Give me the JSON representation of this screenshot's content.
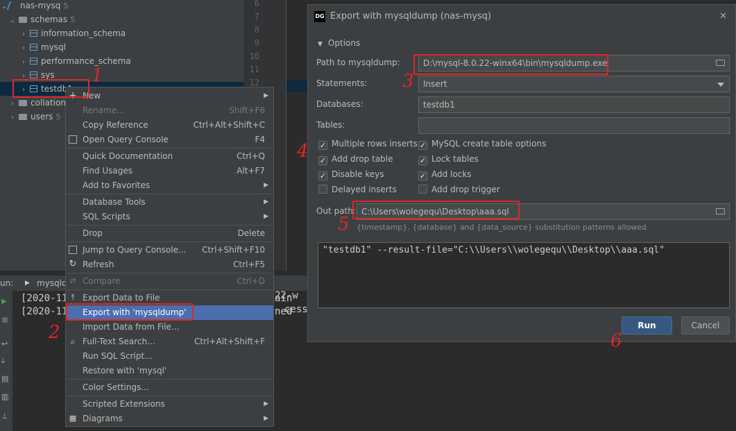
{
  "tree": {
    "root": {
      "label": "nas-mysq",
      "count": "5"
    },
    "schemas": {
      "label": "schemas",
      "count": "5"
    },
    "items": [
      {
        "label": "information_schema"
      },
      {
        "label": "mysql"
      },
      {
        "label": "performance_schema"
      },
      {
        "label": "sys"
      },
      {
        "label": "testdb1"
      }
    ],
    "collations": {
      "label": "collation"
    },
    "users": {
      "label": "users",
      "count": "5"
    }
  },
  "gutter": {
    "lines": [
      "6",
      "7",
      "8",
      "9",
      "10",
      "11",
      "12"
    ]
  },
  "run": {
    "header_label": "un:",
    "tab_label": "mysqld",
    "lines": [
      "[2020-11",
      "[2020-11"
    ],
    "right_fragments": [
      "ain",
      "cess"
    ],
    "right_fragments2": [
      "22-w",
      "ned"
    ]
  },
  "menu": {
    "items": [
      {
        "label": "New",
        "shortcut": "",
        "submenu": true,
        "icon": "plus-icon"
      },
      {
        "label": "Rename...",
        "shortcut": "Shift+F6",
        "disabled": true
      },
      {
        "label": "Copy Reference",
        "shortcut": "Ctrl+Alt+Shift+C"
      },
      {
        "label": "Open Query Console",
        "shortcut": "F4",
        "icon": "console-icon"
      },
      {
        "label": "Quick Documentation",
        "shortcut": "Ctrl+Q"
      },
      {
        "label": "Find Usages",
        "shortcut": "Alt+F7"
      },
      {
        "label": "Add to Favorites",
        "shortcut": "",
        "submenu": true
      },
      {
        "label": "Database Tools",
        "shortcut": "",
        "submenu": true
      },
      {
        "label": "SQL Scripts",
        "shortcut": "",
        "submenu": true
      },
      {
        "label": "Drop",
        "shortcut": "Delete"
      },
      {
        "label": "Jump to Query Console...",
        "shortcut": "Ctrl+Shift+F10",
        "icon": "console-icon"
      },
      {
        "label": "Refresh",
        "shortcut": "Ctrl+F5",
        "icon": "refresh-icon"
      },
      {
        "label": "Compare",
        "shortcut": "Ctrl+D",
        "disabled": true,
        "icon": "compare-icon"
      },
      {
        "label": "Export Data to File",
        "shortcut": "",
        "icon": "export-icon"
      },
      {
        "label": "Export with 'mysqldump'",
        "shortcut": "",
        "active": true
      },
      {
        "label": "Import Data from File...",
        "shortcut": ""
      },
      {
        "label": "Full-Text Search...",
        "shortcut": "Ctrl+Alt+Shift+F",
        "icon": "search-icon"
      },
      {
        "label": "Run SQL Script...",
        "shortcut": ""
      },
      {
        "label": "Restore with 'mysql'",
        "shortcut": ""
      },
      {
        "label": "Color Settings...",
        "shortcut": ""
      },
      {
        "label": "Scripted Extensions",
        "shortcut": "",
        "submenu": true
      },
      {
        "label": "Diagrams",
        "shortcut": "",
        "submenu": true,
        "icon": "diagram-icon"
      }
    ]
  },
  "dialog": {
    "logo": "DG",
    "title": "Export with mysqldump (nas-mysq)",
    "close_glyph": "✕",
    "options_label": "Options",
    "path_label": "Path to mysqldump:",
    "path_value": "D:\\mysql-8.0.22-winx64\\bin\\mysqldump.exe",
    "statements_label": "Statements:",
    "statements_value": "Insert",
    "databases_label": "Databases:",
    "databases_value": "testdb1",
    "tables_label": "Tables:",
    "tables_value": "",
    "checkboxes": [
      {
        "label": "Multiple rows inserts",
        "checked": true
      },
      {
        "label": "MySQL create table options",
        "checked": true
      },
      {
        "label": "Add drop table",
        "checked": true
      },
      {
        "label": "Lock tables",
        "checked": true
      },
      {
        "label": "Disable keys",
        "checked": true
      },
      {
        "label": "Add locks",
        "checked": true
      },
      {
        "label": "Delayed inserts",
        "checked": false
      },
      {
        "label": "Add drop trigger",
        "checked": false
      }
    ],
    "out_path_label": "Out path:",
    "out_path_value": "C:\\Users\\wolegequ\\Desktop\\aaa.sql",
    "hint": "{timestamp}, {database} and {data_source} substitution patterns allowed",
    "command": "\"testdb1\" --result-file=\"C:\\\\Users\\\\wolegequ\\\\Desktop\\\\aaa.sql\"",
    "run_label": "Run",
    "cancel_label": "Cancel"
  },
  "annotations": [
    "1",
    "2",
    "3",
    "4",
    "5",
    "6"
  ],
  "colors": {
    "annotation": "#e0262b",
    "selection": "#4b6eaf",
    "primary_button": "#365880"
  }
}
